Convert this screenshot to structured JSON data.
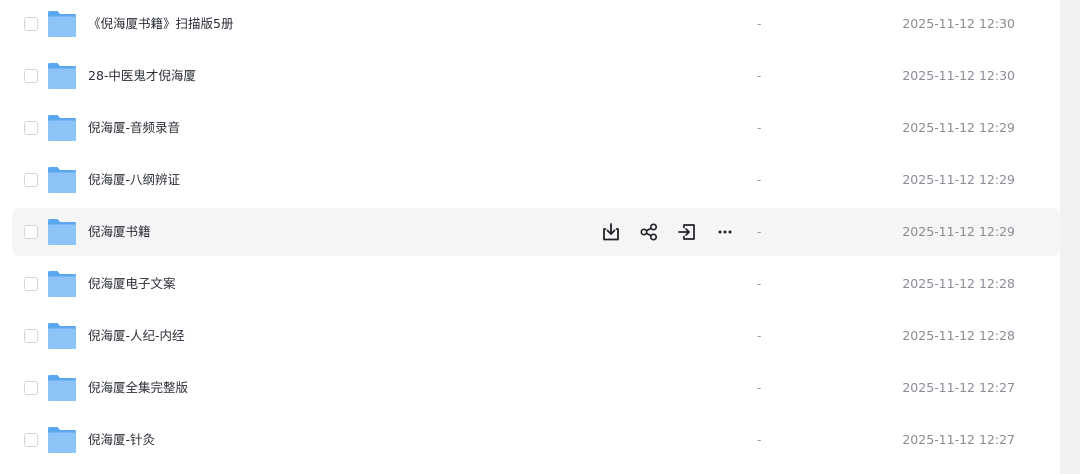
{
  "files": [
    {
      "name": "《倪海厦书籍》扫描版5册",
      "size": "-",
      "modified": "2025-11-12 12:30"
    },
    {
      "name": "28-中医鬼才倪海厦",
      "size": "-",
      "modified": "2025-11-12 12:30"
    },
    {
      "name": "倪海厦-音频录音",
      "size": "-",
      "modified": "2025-11-12 12:29"
    },
    {
      "name": "倪海厦-八纲辨证",
      "size": "-",
      "modified": "2025-11-12 12:29"
    },
    {
      "name": "倪海厦书籍",
      "size": "-",
      "modified": "2025-11-12 12:29"
    },
    {
      "name": "倪海厦电子文案",
      "size": "-",
      "modified": "2025-11-12 12:28"
    },
    {
      "name": "倪海厦-人纪-内经",
      "size": "-",
      "modified": "2025-11-12 12:28"
    },
    {
      "name": "倪海厦全集完整版",
      "size": "-",
      "modified": "2025-11-12 12:27"
    },
    {
      "name": "倪海厦-针灸",
      "size": "-",
      "modified": "2025-11-12 12:27"
    }
  ],
  "hovered_row_index": 4,
  "row_actions": [
    "download-icon",
    "share-icon",
    "move-icon",
    "more-icon"
  ],
  "colors": {
    "folder_front": "#8cc4f7",
    "folder_back": "#5aa8ef",
    "hover_background": "#f5f5f6",
    "time_text": "#8a8d95"
  }
}
